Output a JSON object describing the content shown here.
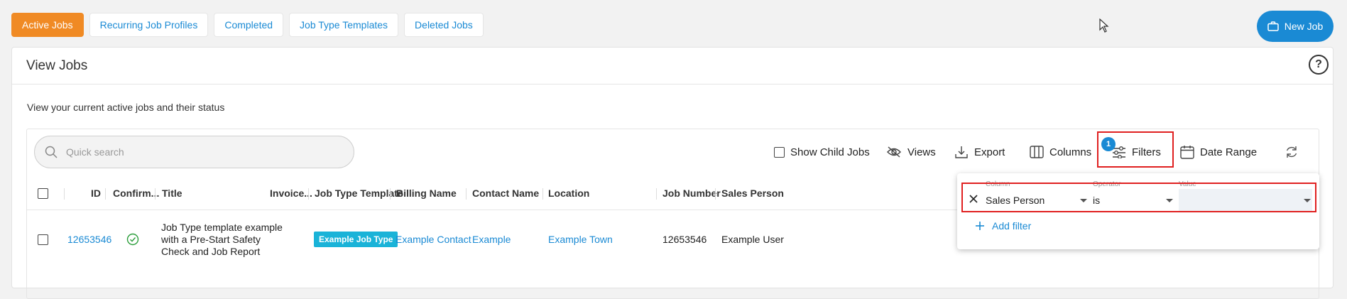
{
  "tabs": [
    {
      "label": "Active Jobs",
      "active": true
    },
    {
      "label": "Recurring Job Profiles"
    },
    {
      "label": "Completed"
    },
    {
      "label": "Job Type Templates"
    },
    {
      "label": "Deleted Jobs"
    }
  ],
  "new_job_label": "New Job",
  "card": {
    "title": "View Jobs",
    "help": "?",
    "subtitle": "View your current active jobs and their status"
  },
  "search": {
    "placeholder": "Quick search"
  },
  "toolbar": {
    "show_child_jobs": "Show Child Jobs",
    "views": "Views",
    "export": "Export",
    "columns": "Columns",
    "filters": "Filters",
    "filters_badge": "1",
    "date_range": "Date Range"
  },
  "columns": [
    "ID",
    "Confirm...",
    "Title",
    "Invoice...",
    "Job Type Template",
    "Billing Name",
    "Contact Name",
    "Location",
    "Job Number",
    "Sales Person"
  ],
  "row": {
    "id": "12653546",
    "title_lines": [
      "Job Type template example",
      "with a Pre-Start Safety",
      "Check and Job Report"
    ],
    "job_type": "Example Job Type",
    "billing_name": "Example Contact",
    "contact_name": "Example",
    "location": "Example Town",
    "job_number": "12653546",
    "sales_person": "Example User"
  },
  "filter_popup": {
    "column_label": "Column",
    "column_value": "Sales Person",
    "operator_label": "Operator",
    "operator_value": "is",
    "value_label": "Value",
    "value_value": "",
    "add_filter": "Add filter"
  },
  "colors": {
    "accent": "#1a8ad4",
    "active_tab": "#f08a24",
    "badge": "#1ab3d8",
    "highlight": "#e02020"
  }
}
